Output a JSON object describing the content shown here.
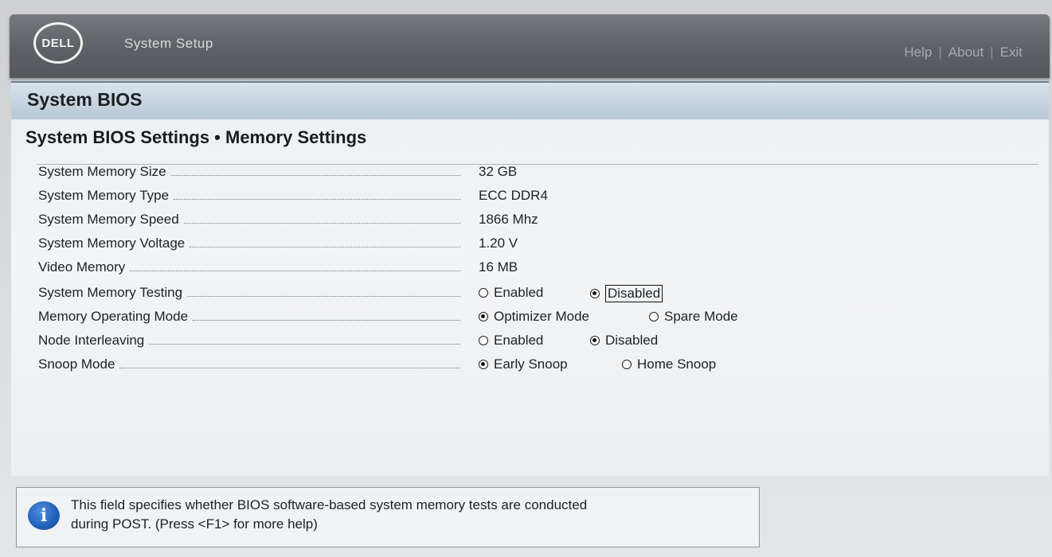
{
  "header": {
    "logo_text": "DELL",
    "app_title": "System Setup",
    "links": [
      "Help",
      "About",
      "Exit"
    ],
    "separator": "|"
  },
  "section": {
    "title": "System BIOS"
  },
  "page": {
    "title": "System BIOS Settings • Memory Settings",
    "info_rows": [
      {
        "label": "System Memory Size",
        "value": "32 GB"
      },
      {
        "label": "System Memory Type",
        "value": "ECC DDR4"
      },
      {
        "label": "System Memory Speed",
        "value": "1866 Mhz"
      },
      {
        "label": "System Memory Voltage",
        "value": "1.20 V"
      },
      {
        "label": "Video Memory",
        "value": "16 MB"
      }
    ],
    "option_rows": [
      {
        "label": "System Memory Testing",
        "options": [
          "Enabled",
          "Disabled"
        ],
        "selected": 1
      },
      {
        "label": "Memory Operating Mode",
        "options": [
          "Optimizer Mode",
          "Spare Mode"
        ],
        "selected": 0
      },
      {
        "label": "Node Interleaving",
        "options": [
          "Enabled",
          "Disabled"
        ],
        "selected": 1
      },
      {
        "label": "Snoop Mode",
        "options": [
          "Early Snoop",
          "Home Snoop"
        ],
        "selected": 0
      }
    ]
  },
  "help": {
    "icon": "info-icon",
    "text_line1": "This field specifies whether BIOS software-based system memory tests are conducted",
    "text_line2": "during POST. (Press <F1> for more help)"
  }
}
